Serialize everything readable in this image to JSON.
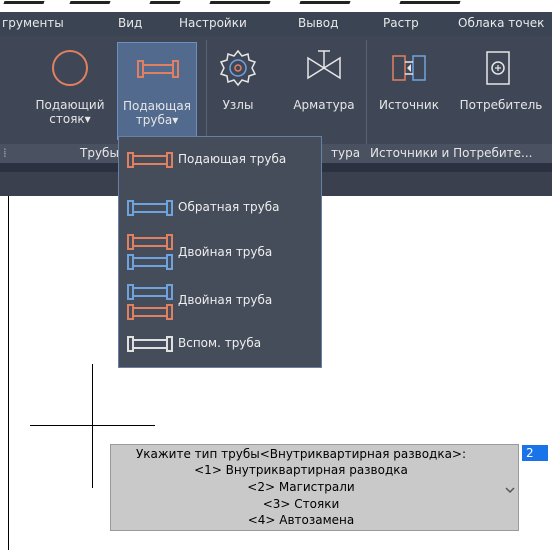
{
  "menu": {
    "items": [
      {
        "label": "грументы"
      },
      {
        "label": "Вид"
      },
      {
        "label": "Настройки"
      },
      {
        "label": "Вывод"
      },
      {
        "label": "Растр"
      },
      {
        "label": "Облака точек"
      }
    ]
  },
  "ribbon": {
    "buttons": [
      {
        "line1": "Подающий",
        "line2": "стояк▾",
        "icon": "circle-riser-icon"
      },
      {
        "line1": "Подающая",
        "line2": "труба▾",
        "icon": "supply-pipe-icon",
        "active": true
      },
      {
        "line1": "Узлы",
        "line2": "",
        "icon": "nodes-icon"
      },
      {
        "line1": "Арматура",
        "line2": "",
        "icon": "valve-icon"
      },
      {
        "line1": "Источник",
        "line2": "",
        "icon": "source-icon"
      },
      {
        "line1": "Потребитель",
        "line2": "",
        "icon": "consumer-icon"
      }
    ],
    "panels": [
      {
        "title": "Трубы"
      },
      {
        "title": "тура"
      },
      {
        "title": "Источники и Потребите..."
      }
    ]
  },
  "dropdown": {
    "items": [
      {
        "label": "Подающая труба",
        "icon": "supply-pipe-icon"
      },
      {
        "label": "Обратная труба",
        "icon": "return-pipe-icon"
      },
      {
        "label": "Двойная труба",
        "icon": "double-pipe-icon"
      },
      {
        "label": "Двойная труба",
        "icon": "double-pipe-reverse-icon"
      },
      {
        "label": "Вспом. труба",
        "icon": "aux-pipe-icon"
      }
    ]
  },
  "command_prompt": {
    "lines": [
      "Укажите тип трубы<Внутриквартирная разводка>:",
      "<1> Внутриквартирная разводка",
      "<2> Магистрали",
      "<3> Стояки",
      "<4> Автозамена"
    ],
    "badge": "2"
  },
  "colors": {
    "supply": "#e08060",
    "return": "#6fa3e0",
    "aux": "#e0e0e0"
  }
}
